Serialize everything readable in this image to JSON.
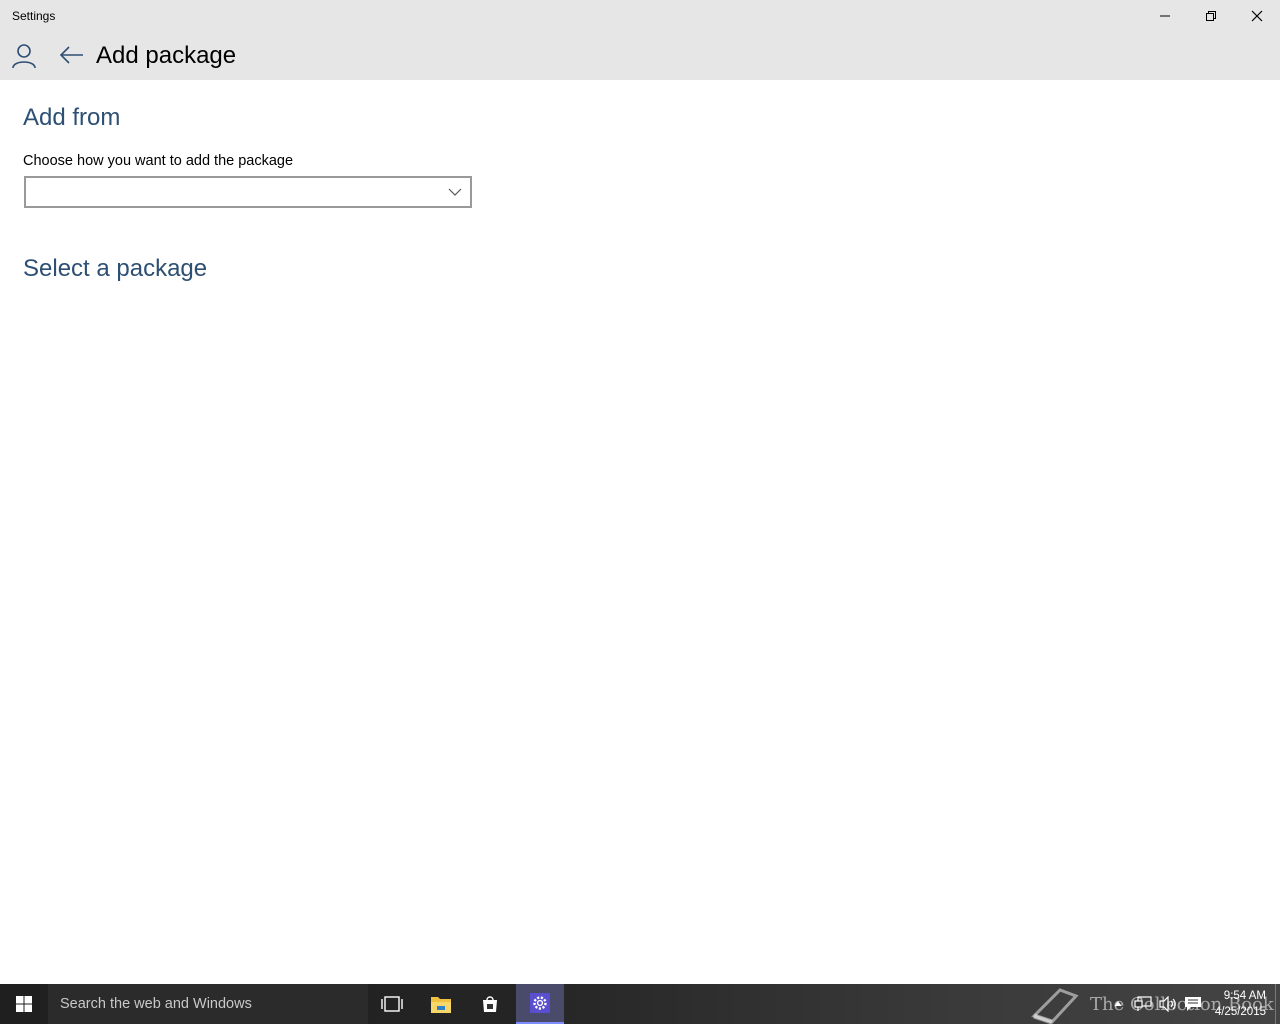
{
  "window": {
    "title": "Settings"
  },
  "header": {
    "page_title": "Add package"
  },
  "add_from": {
    "heading": "Add from",
    "label": "Choose how you want to add the package",
    "combo_value": ""
  },
  "select_package": {
    "heading": "Select a package"
  },
  "taskbar": {
    "search_placeholder": "Search the web and Windows",
    "watermark": "The Collection Book",
    "time": "9:54 AM",
    "date": "4/25/2015"
  },
  "colors": {
    "heading": "#2d4f73",
    "chrome": "#e6e6e6",
    "taskbar_active": "#4a4a6a"
  },
  "icons": [
    "user-icon",
    "back-arrow-icon",
    "minimize-icon",
    "restore-icon",
    "close-icon",
    "chevron-down-icon",
    "windows-logo-icon",
    "task-view-icon",
    "file-explorer-icon",
    "store-icon",
    "settings-gear-icon",
    "book-icon",
    "chevron-up-icon",
    "network-icon",
    "volume-icon",
    "action-center-icon"
  ]
}
